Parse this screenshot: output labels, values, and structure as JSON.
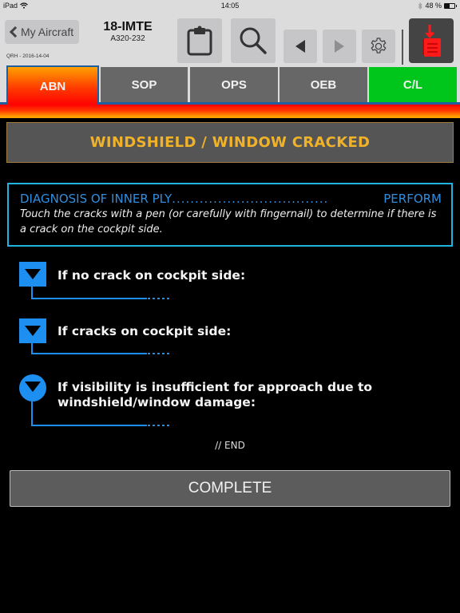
{
  "status_bar": {
    "device": "iPad",
    "time": "14:05",
    "battery_percent_label": "48 %",
    "battery_level": 0.48
  },
  "header": {
    "back_label": "My Aircraft",
    "aircraft_registration": "18-IMTE",
    "aircraft_type": "A320-232",
    "qrh_label": "QRH - 2016-14-04",
    "tools": [
      {
        "name": "clipboard",
        "icon": "clipboard-icon"
      },
      {
        "name": "search",
        "icon": "search-icon"
      },
      {
        "name": "previous",
        "icon": "triangle-left-icon"
      },
      {
        "name": "next",
        "icon": "triangle-right-icon",
        "disabled": true
      },
      {
        "name": "settings",
        "icon": "gear-icon"
      },
      {
        "name": "download",
        "icon": "download-document-icon"
      }
    ]
  },
  "tabs": [
    {
      "label": "ABN",
      "active": true
    },
    {
      "label": "SOP"
    },
    {
      "label": "OPS"
    },
    {
      "label": "OEB"
    },
    {
      "label": "C/L"
    }
  ],
  "procedure": {
    "title": "WINDSHIELD / WINDOW CRACKED",
    "step": {
      "action": "DIAGNOSIS OF INNER PLY",
      "dots": "..................................",
      "response": "PERFORM",
      "note": "Touch the cracks with a pen (or carefully with fingernail) to determine if there is a crack on the cockpit side."
    },
    "conditions": [
      {
        "text": "If no crack on cockpit side:"
      },
      {
        "text": "If cracks on cockpit side:"
      },
      {
        "text": "If visibility is insufficient for approach due to windshield/window damage:"
      }
    ],
    "end_label": "// END",
    "complete_label": "COMPLETE"
  },
  "colors": {
    "accent_blue": "#1d8ff0",
    "title_amber": "#f0b228",
    "abn_red": "#ff0000",
    "cl_green": "#00c51b"
  }
}
